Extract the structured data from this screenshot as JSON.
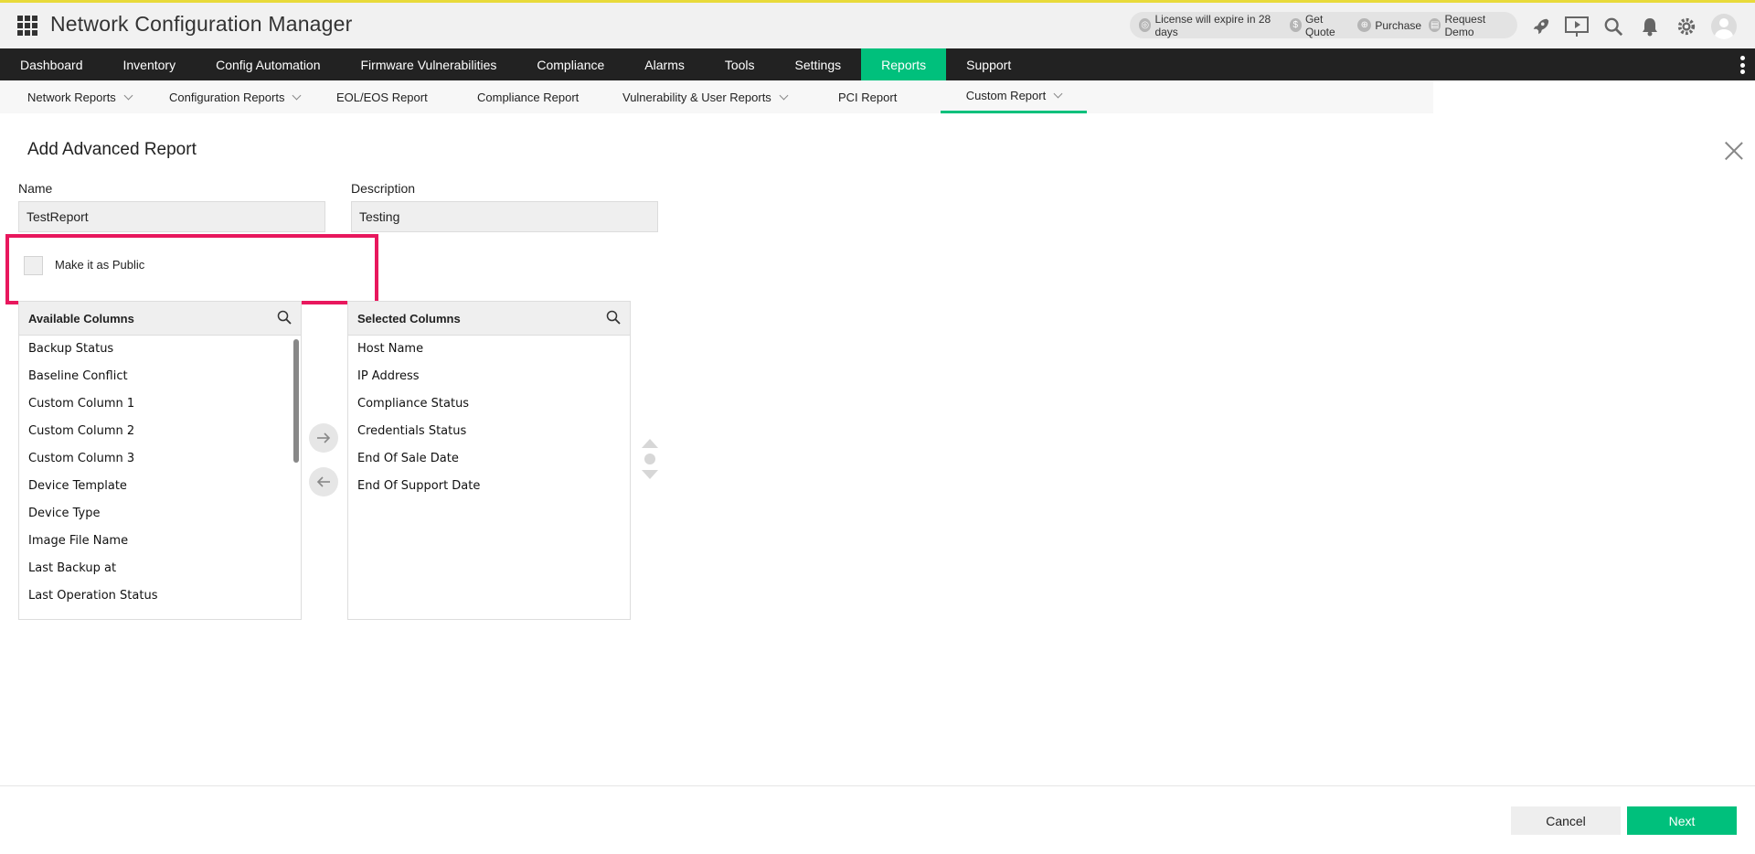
{
  "header": {
    "title": "Network Configuration Manager",
    "license_text": "License will expire in 28 days",
    "get_quote": "Get Quote",
    "purchase": "Purchase",
    "request_demo": "Request Demo"
  },
  "main_nav": {
    "items": [
      {
        "label": "Dashboard"
      },
      {
        "label": "Inventory"
      },
      {
        "label": "Config Automation"
      },
      {
        "label": "Firmware Vulnerabilities"
      },
      {
        "label": "Compliance"
      },
      {
        "label": "Alarms"
      },
      {
        "label": "Tools"
      },
      {
        "label": "Settings"
      },
      {
        "label": "Reports"
      },
      {
        "label": "Support"
      }
    ],
    "active": "Reports"
  },
  "sub_nav": {
    "items": [
      {
        "label": "Network Reports"
      },
      {
        "label": "Configuration Reports"
      },
      {
        "label": "EOL/EOS Report"
      },
      {
        "label": "Compliance Report"
      },
      {
        "label": "Vulnerability & User Reports"
      },
      {
        "label": "PCI Report"
      },
      {
        "label": "Custom Report"
      }
    ],
    "active": "Custom Report"
  },
  "form": {
    "title": "Add Advanced Report",
    "name_label": "Name",
    "name_value": "TestReport",
    "description_label": "Description",
    "description_value": "Testing",
    "public_label": "Make it as Public",
    "public_checked": false
  },
  "available_columns": {
    "title": "Available Columns",
    "items": [
      "Backup Status",
      "Baseline Conflict",
      "Custom Column 1",
      "Custom Column 2",
      "Custom Column 3",
      "Device Template",
      "Device Type",
      "Image File Name",
      "Last Backup at",
      "Last Operation Status"
    ]
  },
  "selected_columns": {
    "title": "Selected Columns",
    "items": [
      "Host Name",
      "IP Address",
      "Compliance Status",
      "Credentials Status",
      "End Of Sale Date",
      "End Of Support Date"
    ]
  },
  "footer": {
    "cancel_label": "Cancel",
    "next_label": "Next"
  },
  "colors": {
    "accent": "#00c07c",
    "highlight": "#e8175d",
    "nav_bg": "#222222"
  }
}
